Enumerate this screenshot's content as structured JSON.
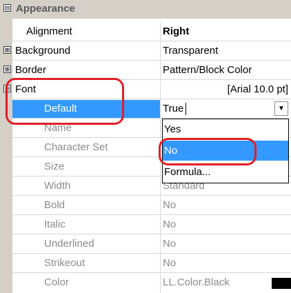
{
  "sections": {
    "appearance": "Appearance",
    "expand_collapse_symbols": {
      "collapsed": "⊟",
      "expanded": "⊞"
    }
  },
  "properties": [
    {
      "name": "Alignment",
      "value": "Right"
    },
    {
      "name": "Background",
      "value": "Transparent"
    },
    {
      "name": "Border",
      "value": "Pattern/Block Color"
    },
    {
      "name": "Font",
      "value": "[Arial 10.0 pt]"
    },
    {
      "name": "Default",
      "value": "True"
    },
    {
      "name": "Name",
      "value": ""
    },
    {
      "name": "Character Set",
      "value": ""
    },
    {
      "name": "Size",
      "value": ""
    },
    {
      "name": "Width",
      "value": "Standard"
    },
    {
      "name": "Bold",
      "value": "No"
    },
    {
      "name": "Italic",
      "value": "No"
    },
    {
      "name": "Underlined",
      "value": "No"
    },
    {
      "name": "Strikeout",
      "value": "No"
    },
    {
      "name": "Color",
      "value": "LL.Color.Black"
    }
  ],
  "dropdown": {
    "options": [
      "Yes",
      "No",
      "Formula..."
    ],
    "selected": "No"
  },
  "colors": {
    "selection": "#3399ff",
    "annotation": "#e01e25",
    "category_background": "#d4d0c8",
    "color_swatch": "#000000"
  }
}
